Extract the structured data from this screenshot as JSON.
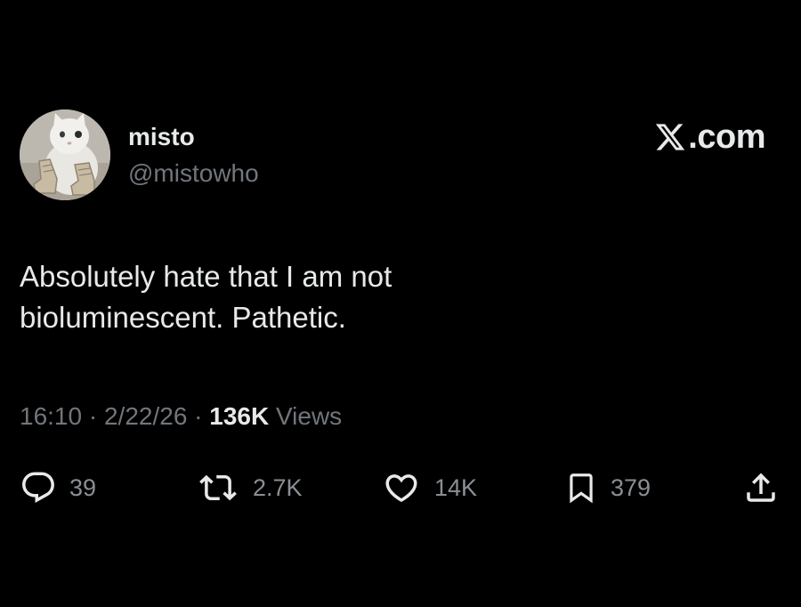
{
  "author": {
    "display_name": "misto",
    "handle": "@mistowho",
    "avatar_icon": "cat-avatar"
  },
  "brand": {
    "icon": "x-logo-icon",
    "text": ".com"
  },
  "tweet": {
    "lines": [
      "Absolutely hate that I am not",
      "bioluminescent. Pathetic."
    ]
  },
  "meta": {
    "time": "16:10",
    "separator": "·",
    "date": "2/22/26",
    "views_count": "136K",
    "views_label": "Views"
  },
  "actions": {
    "reply": {
      "icon": "reply-icon",
      "count": "39"
    },
    "repost": {
      "icon": "repost-icon",
      "count": "2.7K"
    },
    "like": {
      "icon": "heart-icon",
      "count": "14K"
    },
    "bookmark": {
      "icon": "bookmark-icon",
      "count": "379"
    },
    "share": {
      "icon": "share-icon"
    }
  },
  "colors": {
    "background": "#000000",
    "primary_text": "#e7e9ea",
    "secondary_text": "#71767b"
  }
}
